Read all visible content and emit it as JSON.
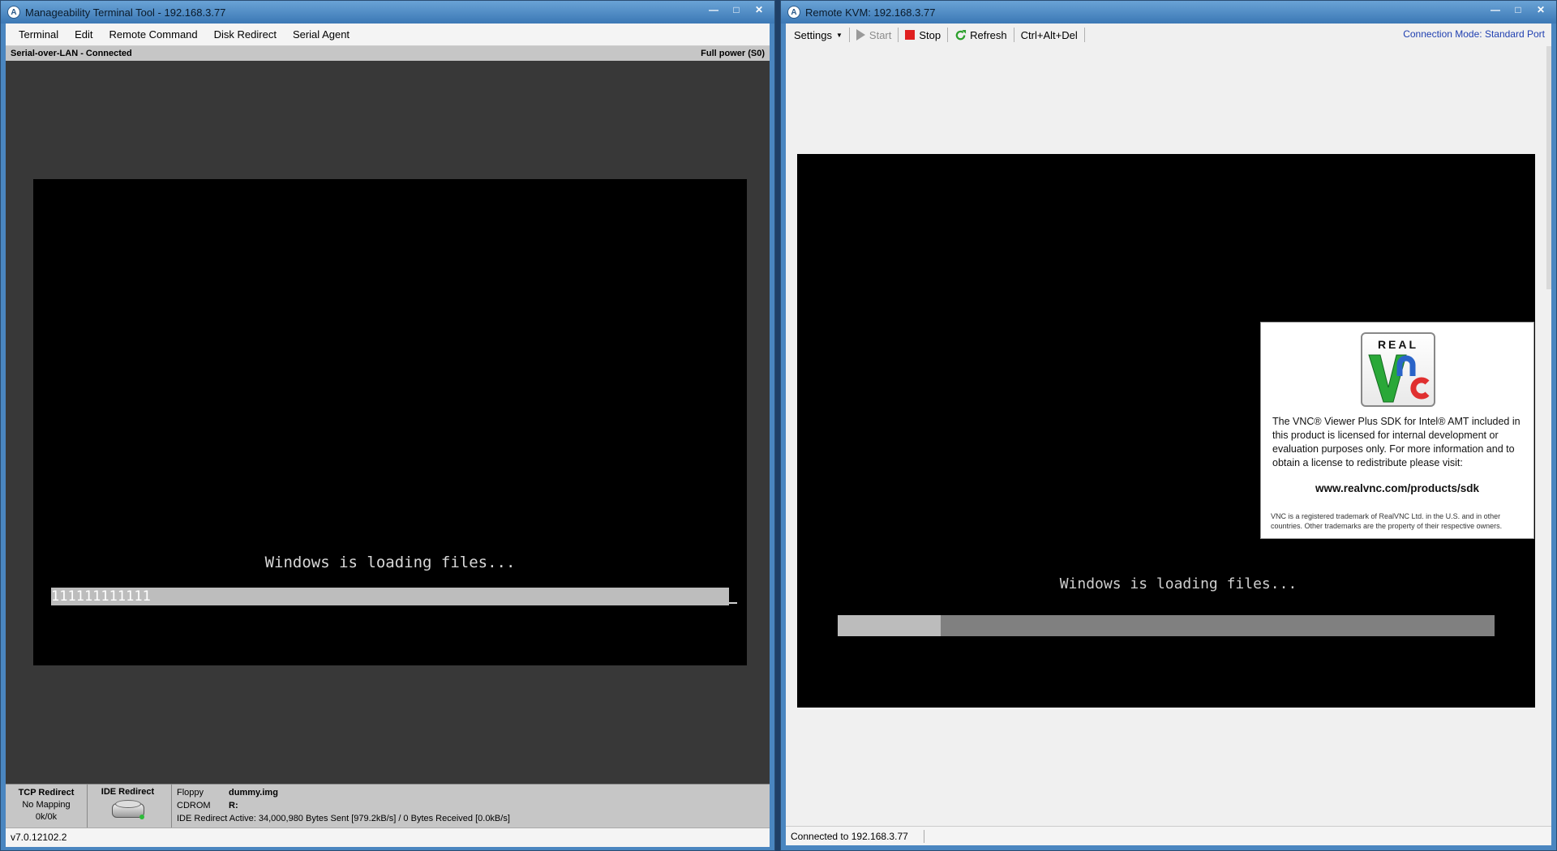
{
  "left_window": {
    "title": "Manageability Terminal Tool - 192.168.3.77",
    "app_icon_letter": "A",
    "menu": [
      "Terminal",
      "Edit",
      "Remote Command",
      "Disk Redirect",
      "Serial Agent"
    ],
    "sol_status": "Serial-over-LAN - Connected",
    "power_status": "Full power (S0)",
    "terminal": {
      "loading_text": "Windows is loading files...",
      "progress_text": "111111111111"
    },
    "tcp_redirect": {
      "title": "TCP Redirect",
      "mapping": "No Mapping",
      "rate": "0k/0k"
    },
    "ide_redirect": {
      "title": "IDE Redirect"
    },
    "media": {
      "floppy_label": "Floppy",
      "floppy_value": "dummy.img",
      "cdrom_label": "CDROM",
      "cdrom_value": "R:",
      "status_line": "IDE Redirect Active: 34,000,980 Bytes Sent [979.2kB/s] / 0 Bytes Received  [0.0kB/s]"
    },
    "version": "v7.0.12102.2"
  },
  "right_window": {
    "title": "Remote KVM: 192.168.3.77",
    "app_icon_letter": "A",
    "toolbar": {
      "settings": "Settings",
      "start": "Start",
      "stop": "Stop",
      "refresh": "Refresh",
      "cad": "Ctrl+Alt+Del"
    },
    "connection_mode": "Connection Mode: Standard Port",
    "screen": {
      "loading_text": "Windows is loading files...",
      "progress_fraction": 0.157
    },
    "vnc_notice": {
      "logo_word": "REAL",
      "logo_letters": "VNC",
      "description": "The VNC® Viewer Plus SDK for Intel® AMT included in this product is licensed for internal development or evaluation purposes only.  For more information and to obtain a license to redistribute please visit:",
      "url": "www.realvnc.com/products/sdk",
      "trademark": "VNC is a registered trademark of RealVNC Ltd. in the U.S. and in other countries. Other trademarks are the property of their respective owners."
    },
    "status": "Connected to 192.168.3.77"
  },
  "colors": {
    "title_gradient_top": "#6aa3d6",
    "terminal_bg": "#383838",
    "stop_red": "#e02020",
    "refresh_green": "#2ca02c",
    "link_blue": "#1f3fb0",
    "vnc_green": "#2aa838",
    "vnc_blue": "#2a64c8",
    "vnc_red": "#e03030"
  },
  "icons": {
    "app": "app-icon",
    "minimize": "minimize-icon",
    "maximize": "maximize-icon",
    "close": "close-icon",
    "play": "play-icon",
    "stop": "stop-icon",
    "refresh": "refresh-icon",
    "disk": "hard-disk-icon"
  }
}
